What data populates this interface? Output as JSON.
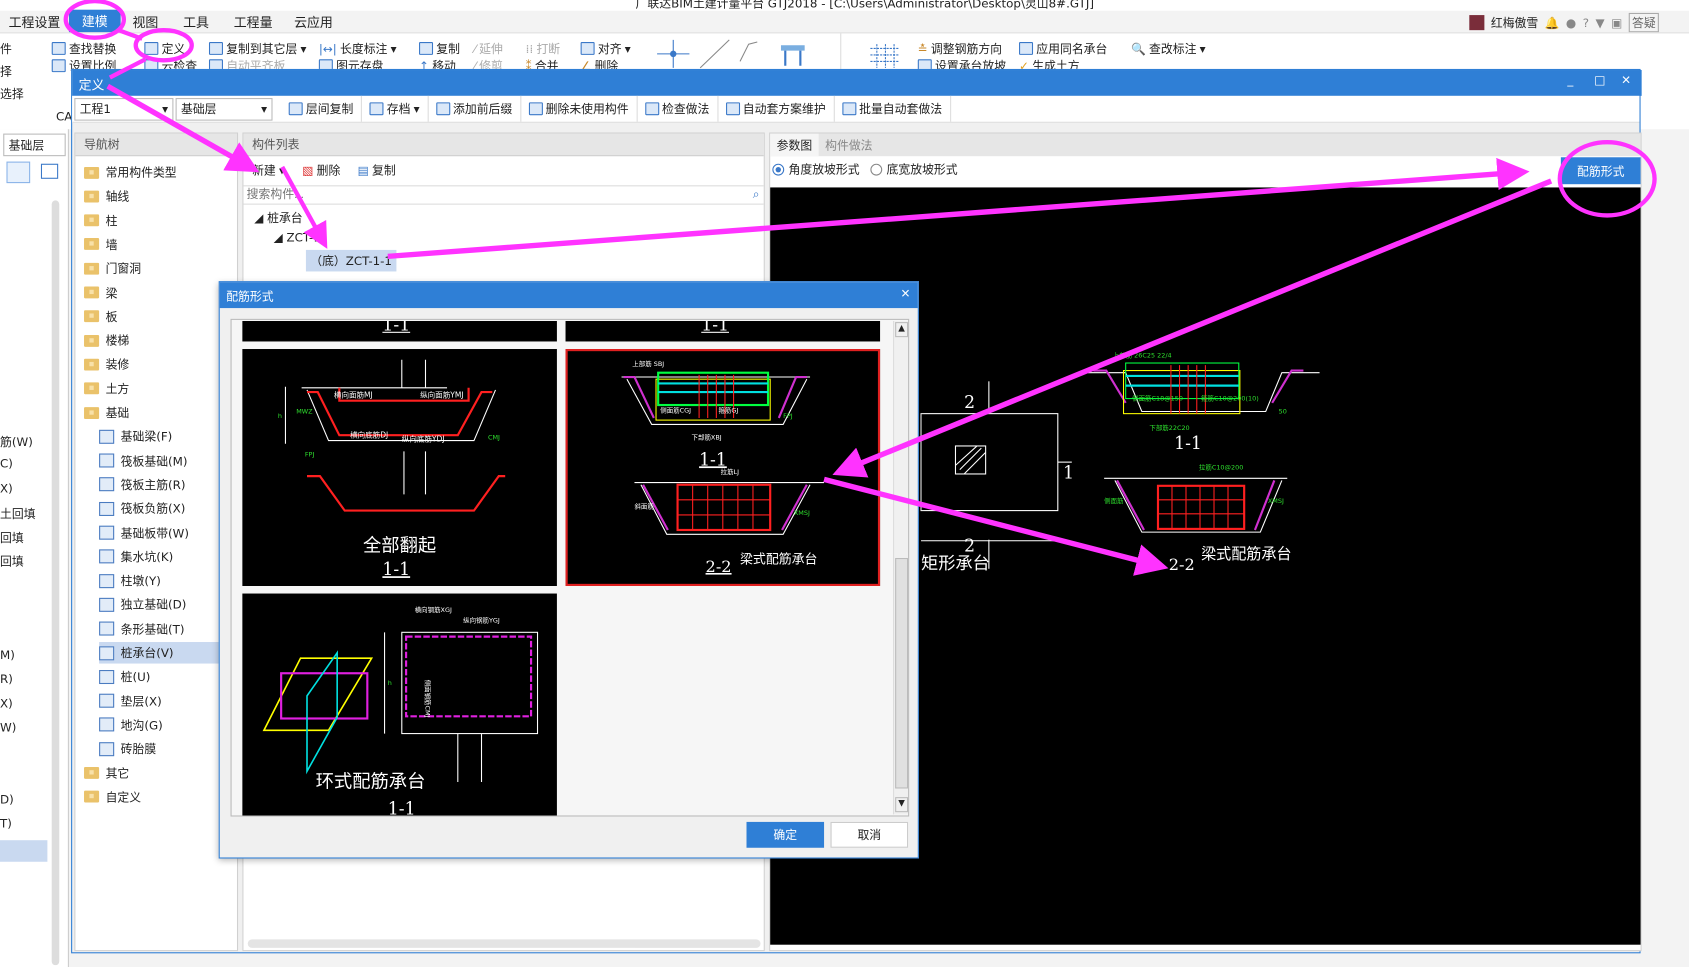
{
  "app": {
    "title": "广联达BIM土建计量平台 GTJ2018 - [C:\\Users\\Administrator\\Desktop\\灵山8#.GTJ]",
    "user": "红梅傲雪",
    "help_box": "答疑"
  },
  "menu": [
    "工程设置",
    "建模",
    "视图",
    "工具",
    "工程量",
    "云应用"
  ],
  "menu_active": "建模",
  "ribbon": {
    "left_partial": [
      "件",
      "择",
      "选择"
    ],
    "cad_partial": "CA",
    "items": [
      "查找替换",
      "定义",
      "复制到其它层",
      "长度标注",
      "复制",
      "延伸",
      "打断",
      "对齐",
      "调整钢筋方向",
      "应用同名承台",
      "查改标注"
    ],
    "row2_partial": [
      "设置比例",
      "云检查",
      "自动平齐板",
      "图元存盘",
      "移动",
      "修剪",
      "合并",
      "删除",
      "设置承台放坡",
      "生成土方"
    ]
  },
  "left_panel": {
    "floor": "基础层",
    "partial_items": [
      "筋(W)",
      "C)",
      "X)",
      "土回填",
      "回填",
      "回填",
      "M)",
      "R)",
      "X)",
      "W)",
      "D)",
      "T)"
    ]
  },
  "define_window": {
    "title": "定义",
    "project": "工程1",
    "floor": "基础层",
    "toolbar": [
      "层间复制",
      "存档",
      "添加前后缀",
      "删除未使用构件",
      "检查做法",
      "自动套方案维护",
      "批量自动套做法"
    ]
  },
  "nav_tree": {
    "header": "导航树",
    "folders": [
      "常用构件类型",
      "轴线",
      "柱",
      "墙",
      "门窗洞",
      "梁",
      "板",
      "楼梯",
      "装修",
      "土方",
      "基础"
    ],
    "children": [
      "基础梁(F)",
      "筏板基础(M)",
      "筏板主筋(R)",
      "筏板负筋(X)",
      "基础板带(W)",
      "集水坑(K)",
      "柱墩(Y)",
      "独立基础(D)",
      "条形基础(T)",
      "桩承台(V)",
      "桩(U)",
      "垫层(X)",
      "地沟(G)",
      "砖胎膜"
    ],
    "selected": "桩承台(V)",
    "tail": [
      "其它",
      "自定义"
    ]
  },
  "component_list": {
    "header": "构件列表",
    "new": "新建",
    "delete": "删除",
    "copy": "复制",
    "search_placeholder": "搜索构件...",
    "tree": [
      "桩承台",
      "ZCT-1",
      "（底）ZCT-1-1"
    ]
  },
  "param_panel": {
    "tabs": [
      "参数图",
      "构件做法"
    ],
    "radio1": "角度放坡形式",
    "radio2": "底宽放坡形式",
    "radio1_checked": true,
    "rebar_button": "配筋形式",
    "canvas": {
      "label_rect": "矩形承台",
      "dim2": "2",
      "dim1": "1",
      "sec11": "1-1",
      "sec22": "2-2",
      "beam_label": "梁式配筋承台",
      "notes": [
        "上部筋 26C25 22/4",
        "侧面筋C18@150",
        "箍筋C10@200(10)",
        "下部筋22C20",
        "拉筋C10@200",
        "侧面筋",
        "XMSJ",
        "50"
      ]
    }
  },
  "dialog": {
    "title": "配筋形式",
    "ok": "确定",
    "cancel": "取消",
    "tiles": [
      {
        "caption": "1-1",
        "title": ""
      },
      {
        "caption": "1-1",
        "title": ""
      },
      {
        "caption": "1-1",
        "title": "全部翻起",
        "labels": [
          "横向面筋MJ",
          "纵向面筋YMJ",
          "横向底筋DJ",
          "纵向底筋YDJ",
          "CMJ",
          "MWZ",
          "FPJ",
          "h"
        ]
      },
      {
        "caption": "2-2",
        "title": "梁式配筋承台",
        "selected": true,
        "labels": [
          "上部筋 SBJ",
          "侧面筋CGJ",
          "箍筋GJ",
          "下部筋XBJ",
          "FPJ",
          "拉筋LJ",
          "斜面筋",
          "XMSJ",
          "1-1"
        ]
      },
      {
        "caption": "1-1",
        "title": "环式配筋承台",
        "labels": [
          "横向钢筋XGJ",
          "纵向钢筋YGJ",
          "侧面钢筋CMJ",
          "h"
        ]
      }
    ]
  },
  "colors": {
    "accent": "#2f7fd6",
    "annotation": "#ff33ff",
    "selection": "#c9d9f0",
    "tile_border": "#e02020"
  }
}
